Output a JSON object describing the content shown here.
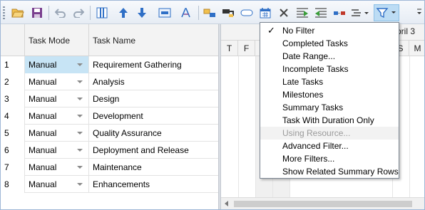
{
  "toolbar": {
    "buttons": [
      {
        "id": "open",
        "icon": "open-folder-icon"
      },
      {
        "id": "save",
        "icon": "save-icon"
      },
      {
        "id": "undo",
        "icon": "undo-icon"
      },
      {
        "id": "redo",
        "icon": "redo-icon"
      },
      {
        "id": "columns",
        "icon": "columns-icon"
      },
      {
        "id": "move-up",
        "icon": "arrow-up-icon"
      },
      {
        "id": "move-down",
        "icon": "arrow-down-icon"
      },
      {
        "id": "task-info",
        "icon": "task-info-icon"
      },
      {
        "id": "font",
        "icon": "font-icon"
      },
      {
        "id": "link",
        "icon": "link-tasks-icon"
      },
      {
        "id": "unlink",
        "icon": "unlink-tasks-icon"
      },
      {
        "id": "inactivate",
        "icon": "inactivate-icon"
      },
      {
        "id": "calendar",
        "icon": "calendar-icon"
      },
      {
        "id": "delete",
        "icon": "delete-icon"
      },
      {
        "id": "indent",
        "icon": "indent-icon"
      },
      {
        "id": "outdent",
        "icon": "outdent-icon"
      },
      {
        "id": "split",
        "icon": "split-task-icon"
      },
      {
        "id": "zoom",
        "icon": "zoom-dropdown-icon"
      },
      {
        "id": "filter",
        "icon": "filter-dropdown-icon"
      }
    ],
    "colors": {
      "accent_blue": "#2f6fc6",
      "folder_yellow": "#f2c14e",
      "save_purple": "#7a3f8e",
      "red_x": "#c0392b",
      "green_arrow": "#3a9d3a"
    }
  },
  "grid": {
    "columns": {
      "mode": "Task Mode",
      "name": "Task Name"
    },
    "rows": [
      {
        "num": "1",
        "mode": "Manual",
        "name": "Requirement Gathering"
      },
      {
        "num": "2",
        "mode": "Manual",
        "name": "Analysis"
      },
      {
        "num": "3",
        "mode": "Manual",
        "name": "Design"
      },
      {
        "num": "4",
        "mode": "Manual",
        "name": "Development"
      },
      {
        "num": "5",
        "mode": "Manual",
        "name": "Quality Assurance"
      },
      {
        "num": "6",
        "mode": "Manual",
        "name": "Deployment and Release"
      },
      {
        "num": "7",
        "mode": "Manual",
        "name": "Maintenance"
      },
      {
        "num": "8",
        "mode": "Manual",
        "name": "Enhancements"
      }
    ]
  },
  "gantt": {
    "week_label": "pril 3",
    "days": [
      "T",
      "F",
      "S",
      "M"
    ]
  },
  "filter_menu": {
    "items": [
      {
        "label": "No Filter",
        "checked": true,
        "enabled": true
      },
      {
        "label": "Completed Tasks",
        "checked": false,
        "enabled": true
      },
      {
        "label": "Date Range...",
        "checked": false,
        "enabled": true
      },
      {
        "label": "Incomplete Tasks",
        "checked": false,
        "enabled": true
      },
      {
        "label": "Late Tasks",
        "checked": false,
        "enabled": true
      },
      {
        "label": "Milestones",
        "checked": false,
        "enabled": true
      },
      {
        "label": "Summary Tasks",
        "checked": false,
        "enabled": true
      },
      {
        "label": "Task With Duration Only",
        "checked": false,
        "enabled": true
      },
      {
        "label": "Using Resource...",
        "checked": false,
        "enabled": false
      },
      {
        "label": "Advanced Filter...",
        "checked": false,
        "enabled": true
      },
      {
        "label": "More Filters...",
        "checked": false,
        "enabled": true
      },
      {
        "label": "Show Related Summary Rows",
        "checked": false,
        "enabled": true
      }
    ],
    "check_glyph": "✓"
  }
}
